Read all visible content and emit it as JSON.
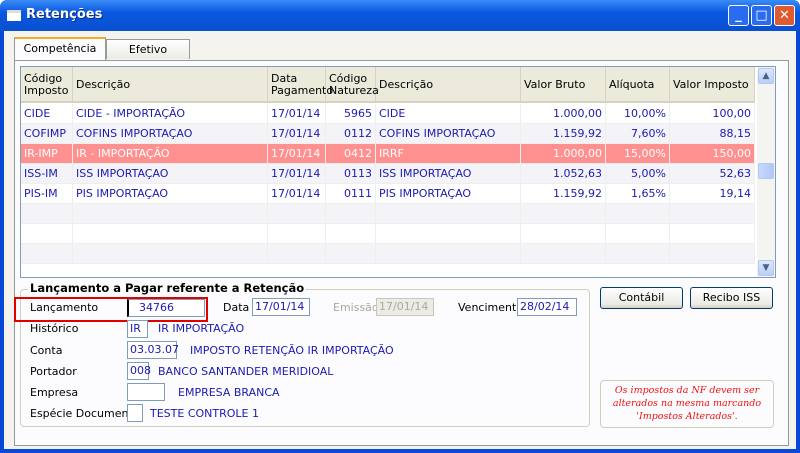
{
  "window": {
    "title": "Retenções",
    "controls": {
      "minimize": "_",
      "maximize": "□",
      "close": "✕"
    }
  },
  "tabs": [
    {
      "label": "Competência <<"
    },
    {
      "label": "Efetivo"
    }
  ],
  "grid": {
    "columns": [
      "Código Imposto",
      "Descrição",
      "Data Pagamento",
      "Código Natureza",
      "Descrição",
      "Valor Bruto",
      "Alíquota",
      "Valor Imposto"
    ],
    "rows": [
      [
        "CIDE",
        "CIDE - IMPORTAÇÃO",
        "17/01/14",
        "5965",
        "CIDE",
        "1.000,00",
        "10,00%",
        "100,00"
      ],
      [
        "COFIMP",
        "COFINS IMPORTAÇAO",
        "17/01/14",
        "0112",
        "COFINS IMPORTAÇAO",
        "1.159,92",
        "7,60%",
        "88,15"
      ],
      [
        "IR-IMP",
        "IR - IMPORTAÇÃO",
        "17/01/14",
        "0412",
        "IRRF",
        "1.000,00",
        "15,00%",
        "150,00"
      ],
      [
        "ISS-IM",
        "ISS IMPORTAÇAO",
        "17/01/14",
        "0113",
        "ISS IMPORTAÇAO",
        "1.052,63",
        "5,00%",
        "52,63"
      ],
      [
        "PIS-IM",
        "PIS IMPORTAÇAO",
        "17/01/14",
        "0111",
        "PIS IMPORTAÇAO",
        "1.159,92",
        "1,65%",
        "19,14"
      ]
    ],
    "selected_row": 2,
    "selected_color": "#ff9090"
  },
  "form": {
    "group_title": "Lançamento a Pagar referente a Retenção",
    "lancamento": {
      "label": "Lançamento",
      "value": "34766"
    },
    "data": {
      "label": "Data",
      "value": "17/01/14"
    },
    "emissao": {
      "label": "Emissão",
      "value": "17/01/14"
    },
    "vencimento": {
      "label": "Vencimento",
      "value": "28/02/14"
    },
    "historico": {
      "label": "Histórico",
      "value": "IR",
      "desc": "IR IMPORTAÇÃO"
    },
    "conta": {
      "label": "Conta",
      "value": "03.03.07",
      "desc": "IMPOSTO RETENÇÃO IR IMPORTAÇÃO"
    },
    "portador": {
      "label": "Portador",
      "value": "008",
      "desc": "BANCO SANTANDER MERIDIOAL"
    },
    "empresa": {
      "label": "Empresa",
      "value": "",
      "desc": "EMPRESA BRANCA"
    },
    "especie": {
      "label": "Espécie Documento",
      "value": "",
      "desc": "TESTE CONTROLE 1"
    }
  },
  "buttons": {
    "contabil": "Contábil",
    "recibo": "Recibo ISS"
  },
  "note": "Os impostos da NF devem ser alterados na mesma marcando 'Impostos Alterados'."
}
